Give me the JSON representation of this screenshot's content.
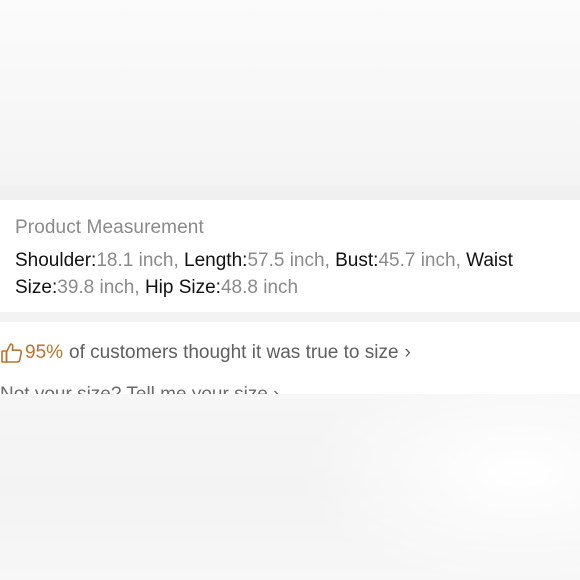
{
  "measurement": {
    "title": "Product Measurement",
    "items": [
      {
        "label": "Shoulder:",
        "value": "18.1 inch",
        "sep": ", "
      },
      {
        "label": "Length:",
        "value": "57.5 inch",
        "sep": ", "
      },
      {
        "label": "Bust:",
        "value": "45.7 inch",
        "sep": ", "
      },
      {
        "label": "Waist Size:",
        "value": "39.8 inch",
        "sep": ", "
      },
      {
        "label": "Hip Size:",
        "value": "48.8 inch",
        "sep": ""
      }
    ]
  },
  "fit": {
    "icon": "thumbs-up-icon",
    "percent": "95%",
    "text": "of customers thought it was true to size",
    "chevron": "›",
    "tell_size": "Not your size? Tell me your size ›"
  },
  "colors": {
    "accent": "#b8742f",
    "label": "#111111",
    "value": "#8a8a8a",
    "background": "#ffffff"
  }
}
